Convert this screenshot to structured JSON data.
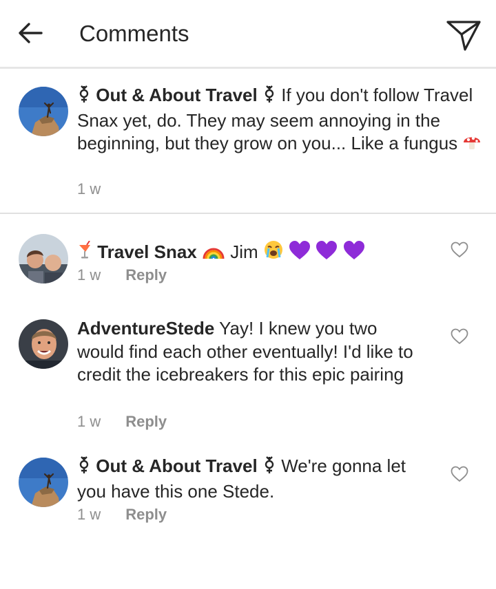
{
  "header": {
    "title": "Comments",
    "back_icon": "back-arrow-icon",
    "send_icon": "paper-plane-icon"
  },
  "caption": {
    "username": "Out & About Travel",
    "text": " If you don't follow Travel Snax yet, do. They may seem annoying in the beginning, but they grow on you... Like a fungus",
    "time": "1 w"
  },
  "comments": [
    {
      "username": "Travel Snax",
      "text": "Jim",
      "time": "1 w",
      "reply_label": "Reply"
    },
    {
      "username": "AdventureStede",
      "text": " Yay! I knew you two would find each other eventually! I'd like to credit the icebreakers for this epic pairing",
      "time": "1 w",
      "reply_label": "Reply"
    },
    {
      "username": "Out & About Travel",
      "text": " We're gonna let you have this one Stede.",
      "time": "1 w",
      "reply_label": "Reply"
    }
  ],
  "colors": {
    "text": "#262626",
    "secondary": "#8e8e8e",
    "divider": "#e6e6e6",
    "heart_purple": "#8e2bd8"
  }
}
